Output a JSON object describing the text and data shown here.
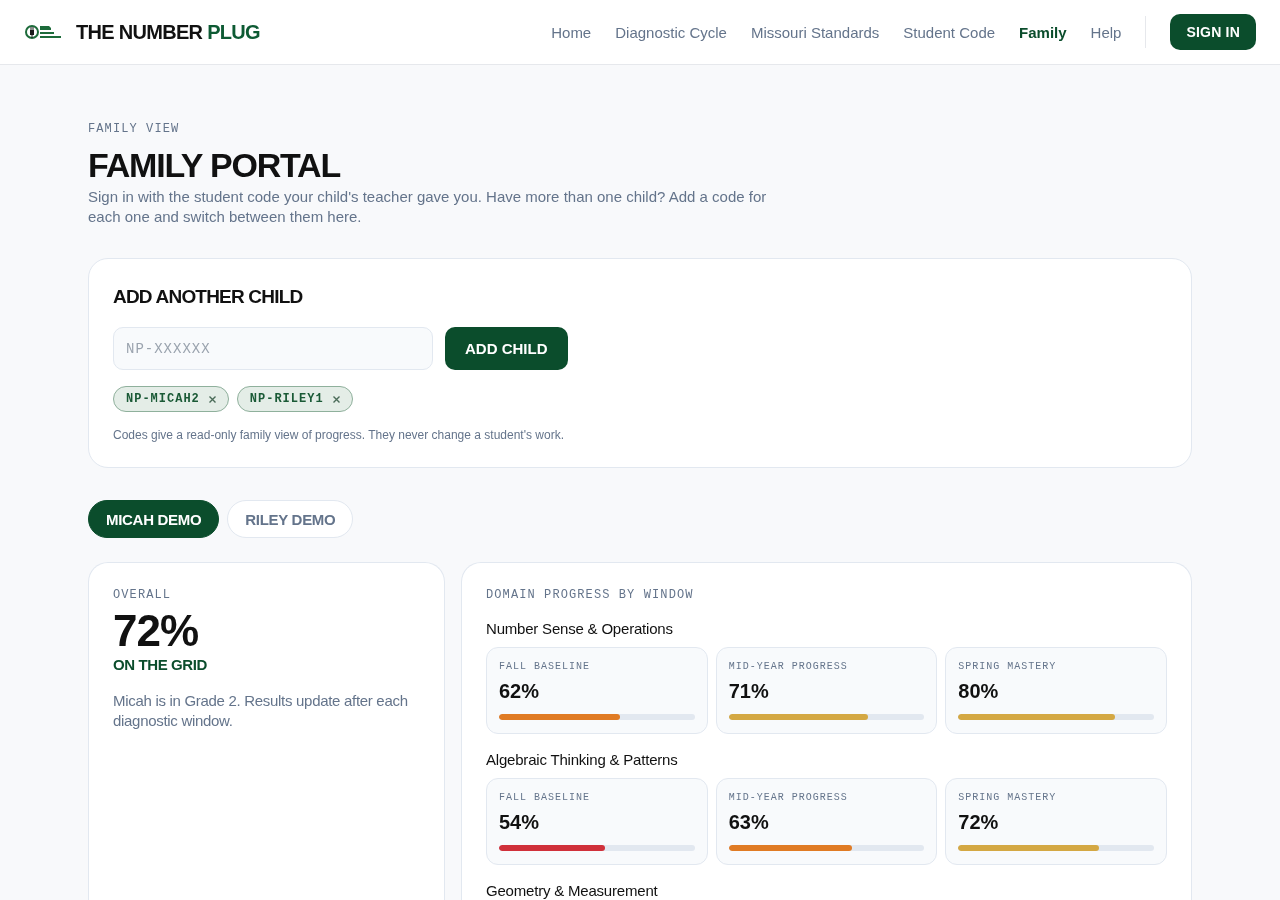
{
  "header": {
    "brand": {
      "text": "THE NUMBER",
      "accent": "PLUG"
    },
    "nav": [
      {
        "label": "Home",
        "selected": false
      },
      {
        "label": "Diagnostic Cycle",
        "selected": false
      },
      {
        "label": "Missouri Standards",
        "selected": false
      },
      {
        "label": "Student Code",
        "selected": false
      },
      {
        "label": "Family",
        "selected": true
      },
      {
        "label": "Help",
        "selected": false
      }
    ],
    "sign_in": "SIGN IN"
  },
  "intro": {
    "eyebrow": "FAMILY VIEW",
    "title": "FAMILY PORTAL",
    "description": "Sign in with the student code your child's teacher gave you. Have more than one child? Add a code for each one and switch between them here."
  },
  "add_child": {
    "title": "ADD ANOTHER CHILD",
    "input": {
      "placeholder": "NP-XXXXXX"
    },
    "button": "ADD CHILD",
    "codes": [
      "NP-MICAH2",
      "NP-RILEY1"
    ],
    "note": "Codes give a read-only family view of progress. They never change a student's work."
  },
  "child_tabs": [
    {
      "label": "MICAH DEMO",
      "selected": true
    },
    {
      "label": "RILEY DEMO",
      "selected": false
    }
  ],
  "overall": {
    "label": "OVERALL",
    "value": "72%",
    "status": "ON THE GRID",
    "description": "Micah is in Grade 2. Results update after each diagnostic window."
  },
  "domain_progress": {
    "title": "DOMAIN PROGRESS BY WINDOW",
    "domains": [
      {
        "name": "Number Sense & Operations",
        "windows": [
          {
            "label": "FALL BASELINE",
            "value": "62%",
            "level": 0.62,
            "color": "#e07b24"
          },
          {
            "label": "MID-YEAR PROGRESS",
            "value": "71%",
            "level": 0.71,
            "color": "#d4a843"
          },
          {
            "label": "SPRING MASTERY",
            "value": "80%",
            "level": 0.8,
            "color": "#d4a843"
          }
        ]
      },
      {
        "name": "Algebraic Thinking & Patterns",
        "windows": [
          {
            "label": "FALL BASELINE",
            "value": "54%",
            "level": 0.54,
            "color": "#d0303a"
          },
          {
            "label": "MID-YEAR PROGRESS",
            "value": "63%",
            "level": 0.63,
            "color": "#e07b24"
          },
          {
            "label": "SPRING MASTERY",
            "value": "72%",
            "level": 0.72,
            "color": "#d4a843"
          }
        ]
      },
      {
        "name": "Geometry & Measurement"
      }
    ]
  }
}
